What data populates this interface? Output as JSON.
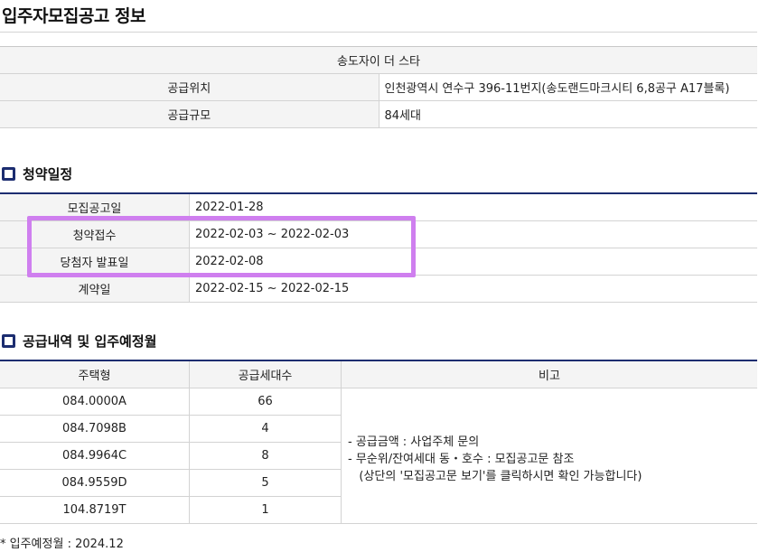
{
  "page": {
    "title": "입주자모집공고 정보"
  },
  "info": {
    "complex_name": "송도자이 더 스타",
    "rows": [
      {
        "label": "공급위치",
        "value": "인천광역시 연수구 396-11번지(송도랜드마크시티 6,8공구 A17블록)"
      },
      {
        "label": "공급규모",
        "value": "84세대"
      }
    ]
  },
  "schedule": {
    "title": "청약일정",
    "rows": [
      {
        "label": "모집공고일",
        "value": "2022-01-28"
      },
      {
        "label": "청약접수",
        "value": "2022-02-03 ~ 2022-02-03"
      },
      {
        "label": "당첨자 발표일",
        "value": "2022-02-08"
      },
      {
        "label": "계약일",
        "value": "2022-02-15 ~ 2022-02-15"
      }
    ]
  },
  "supply": {
    "title": "공급내역 및 입주예정월",
    "headers": {
      "type": "주택형",
      "count": "공급세대수",
      "note": "비고"
    },
    "rows": [
      {
        "type": "084.0000A",
        "count": "66"
      },
      {
        "type": "084.7098B",
        "count": "4"
      },
      {
        "type": "084.9964C",
        "count": "8"
      },
      {
        "type": "084.9559D",
        "count": "5"
      },
      {
        "type": "104.8719T",
        "count": "1"
      }
    ],
    "notes": [
      "-  공급금액 : 사업주체 문의",
      "-  무순위/잔여세대 동・호수 : 모집공고문 참조",
      "   (상단의 '모집공고문 보기'를 클릭하시면 확인 가능합니다)"
    ]
  },
  "footnote": "* 입주예정월 : 2024.12",
  "colors": {
    "navy": "#1c2d70",
    "highlight": "#cf7fef",
    "header_bg": "#f4f4f4"
  }
}
